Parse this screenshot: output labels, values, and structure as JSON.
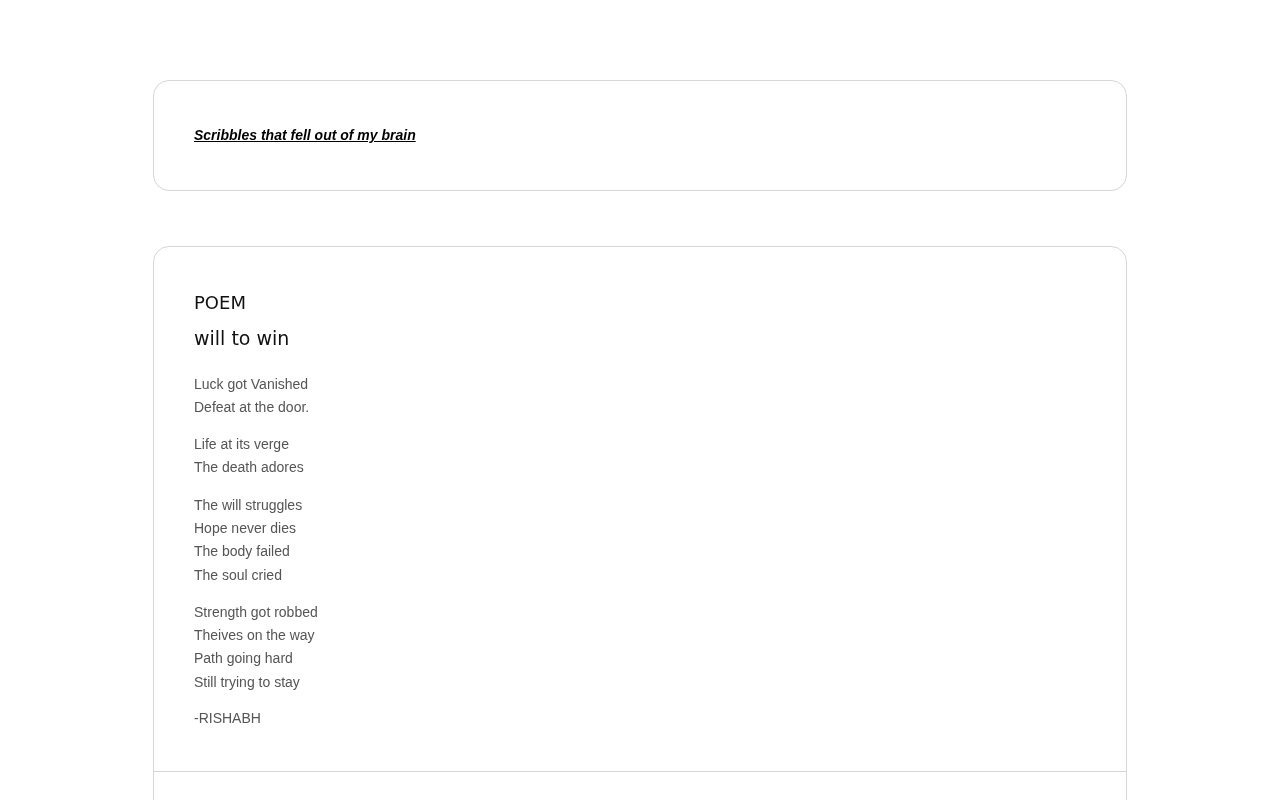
{
  "header": {
    "title": "Scribbles that fell out of my brain"
  },
  "post": {
    "category": "POEM",
    "title": "will to win",
    "stanzas": [
      [
        "Luck got Vanished",
        "Defeat at the door."
      ],
      [
        "Life at its verge",
        "The death adores"
      ],
      [
        "The will struggles",
        "Hope never dies",
        "The body failed",
        "The soul cried"
      ],
      [
        "Strength got robbed",
        "Theives on the way",
        "Path going hard",
        "Still trying to stay"
      ]
    ],
    "signature": "-RISHABH"
  }
}
